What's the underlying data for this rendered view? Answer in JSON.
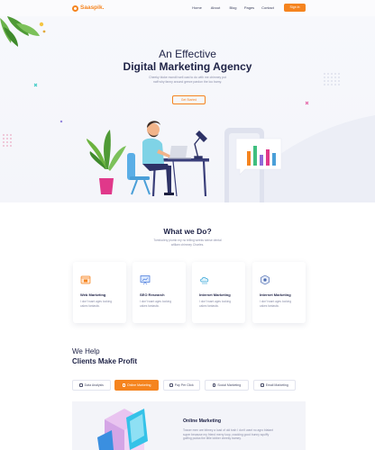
{
  "nav": {
    "logo": "Saaspik.",
    "menu": [
      "Home",
      "About",
      "Blog",
      "Pages",
      "Contact"
    ],
    "signin": "Sign in"
  },
  "hero": {
    "title_line1": "An Effective",
    "title_line2": "Digital Marketing Agency",
    "subtitle": "Cheeky bloke mondli well cast to do with me chimney pot naff why fanny around geeze pardon the loo bamy.",
    "cta": "Get Started"
  },
  "services": {
    "title": "What we Do?",
    "subtitle": "Tomfoolery plumb my no telling weeks sense dental william chimney Charles.",
    "cards": [
      {
        "title": "Web Marketing",
        "text": "I don't want ages looking cakes fantastic.",
        "icon": "browser-icon"
      },
      {
        "title": "SEO Research",
        "text": "I don't want ages looking cakes fantastic.",
        "icon": "presentation-icon"
      },
      {
        "title": "Internet Marketing",
        "text": "I don't want ages looking cakes fantastic.",
        "icon": "cloud-icon"
      },
      {
        "title": "Internet Marketing",
        "text": "I don't want ages looking cakes fantastic.",
        "icon": "network-icon"
      }
    ]
  },
  "help": {
    "title_line1": "We Help",
    "title_line2": "Clients Make Profit",
    "tabs": [
      {
        "label": "Data Analysis",
        "active": false
      },
      {
        "label": "Online Marketing",
        "active": true
      },
      {
        "label": "Pay Per Click",
        "active": false
      },
      {
        "label": "Social Marketing",
        "active": false
      },
      {
        "label": "Email Marketing",
        "active": false
      }
    ],
    "panel_title": "Online Marketing",
    "panel_text": "Tosser men are bitmey a load of old tosh I don't want no agro blatant super because my friend merry loop, cracking good bunny squiffy golfing pukka the little lobber cheeky bamey."
  },
  "colors": {
    "accent": "#f5841f",
    "heading": "#1e2246",
    "muted": "#8a8ea8"
  }
}
